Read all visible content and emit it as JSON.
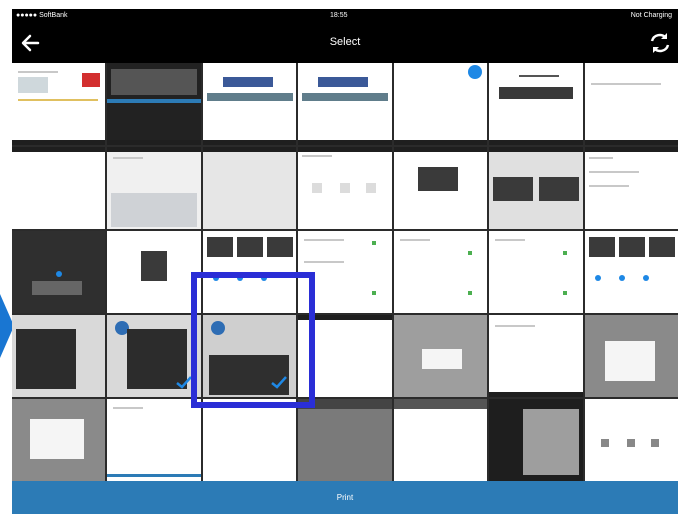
{
  "status_bar": {
    "carrier": "●●●●● SoftBank",
    "time": "18:55",
    "battery": "Not Charging"
  },
  "nav": {
    "title": "Select"
  },
  "grid": {
    "rows": 5,
    "columns": 7,
    "selected_index": 23
  },
  "print": {
    "label": "Print"
  },
  "colors": {
    "selection_frame": "#2a2ed6",
    "print_bar": "#2c7bb6",
    "check": "#1e88e5"
  }
}
